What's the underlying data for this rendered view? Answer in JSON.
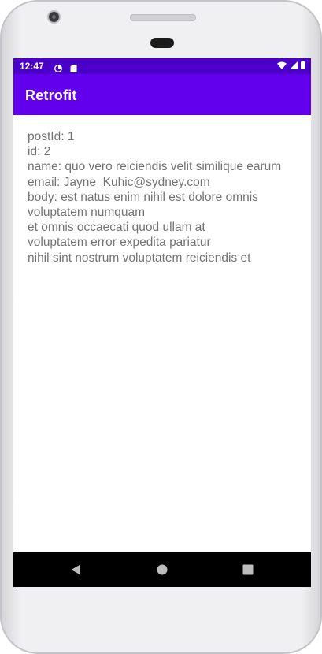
{
  "status_bar": {
    "time": "12:47",
    "icons": [
      "data-saver-icon",
      "sd-card-icon",
      "wifi-icon",
      "signal-icon",
      "battery-icon"
    ]
  },
  "app_bar": {
    "title": "Retrofit"
  },
  "comment": {
    "lines": [
      "postId: 1",
      "id: 2",
      "name: quo vero reiciendis velit similique earum",
      "email: Jayne_Kuhic@sydney.com",
      "body: est natus enim nihil est dolore omnis",
      "voluptatem numquam",
      "et omnis occaecati quod ullam at",
      "voluptatem error expedita pariatur",
      "nihil sint nostrum voluptatem reiciendis et"
    ]
  },
  "nav_bar": {
    "buttons": [
      "back-icon",
      "home-icon",
      "recents-icon"
    ]
  },
  "colors": {
    "status_bar": "#4b00c9",
    "app_bar": "#6200ee",
    "text": "#737373",
    "nav_bar": "#000000"
  }
}
